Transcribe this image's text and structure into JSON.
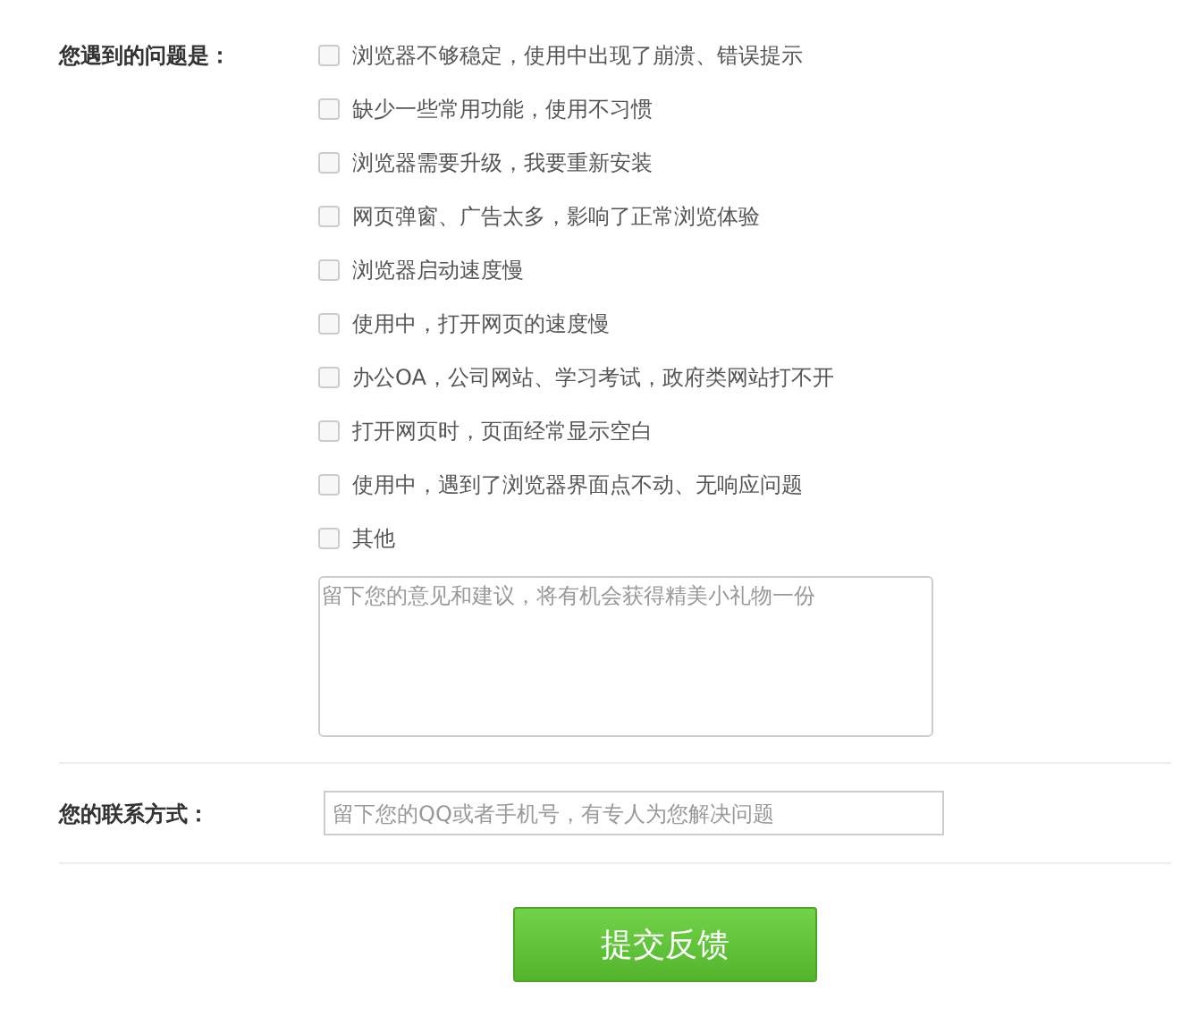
{
  "problems": {
    "label": "您遇到的问题是：",
    "options": [
      {
        "label": "浏览器不够稳定，使用中出现了崩溃、错误提示",
        "checked": false
      },
      {
        "label": "缺少一些常用功能，使用不习惯",
        "checked": false
      },
      {
        "label": "浏览器需要升级，我要重新安装",
        "checked": false
      },
      {
        "label": "网页弹窗、广告太多，影响了正常浏览体验",
        "checked": false
      },
      {
        "label": "浏览器启动速度慢",
        "checked": false
      },
      {
        "label": "使用中，打开网页的速度慢",
        "checked": false
      },
      {
        "label": "办公OA，公司网站、学习考试，政府类网站打不开",
        "checked": false
      },
      {
        "label": "打开网页时，页面经常显示空白",
        "checked": false
      },
      {
        "label": "使用中，遇到了浏览器界面点不动、无响应问题",
        "checked": false
      },
      {
        "label": "其他",
        "checked": false
      }
    ],
    "comment": {
      "placeholder": "留下您的意见和建议，将有机会获得精美小礼物一份"
    }
  },
  "contact": {
    "label": "您的联系方式：",
    "placeholder": "留下您的QQ或者手机号，有专人为您解决问题"
  },
  "submit": "提交反馈"
}
